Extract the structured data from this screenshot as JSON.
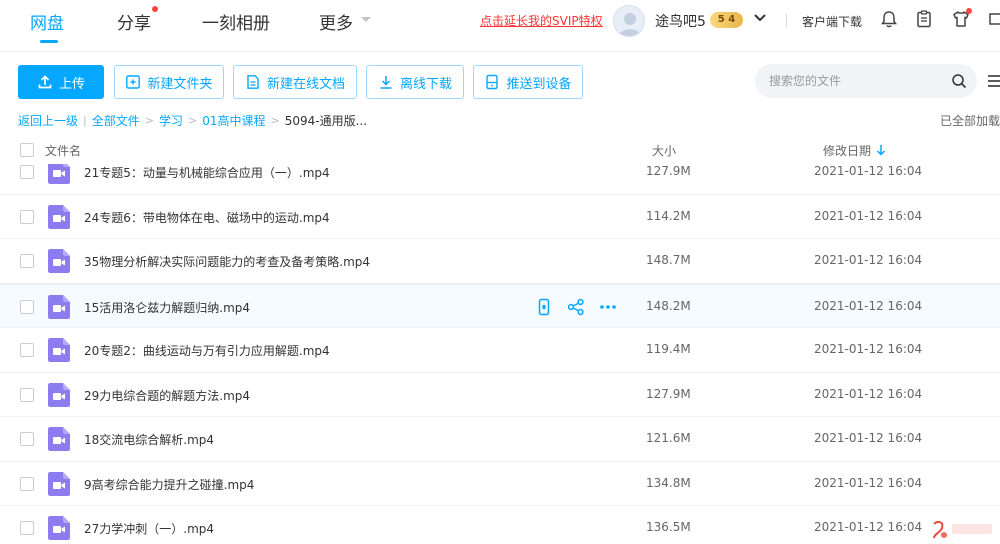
{
  "nav": {
    "items": [
      {
        "label": "网盘"
      },
      {
        "label": "分享"
      },
      {
        "label": "一刻相册"
      },
      {
        "label": "更多"
      }
    ],
    "promo": "点击延长我的SVIP特权",
    "username": "途鸟吧5",
    "vip_level": "5 4",
    "client_download": "客户端下载"
  },
  "toolbar": {
    "upload": "上传",
    "new_folder": "新建文件夹",
    "new_doc": "新建在线文档",
    "offline_download": "离线下载",
    "push_device": "推送到设备",
    "search_placeholder": "搜索您的文件"
  },
  "breadcrumb": {
    "back": "返回上一级",
    "items": [
      "全部文件",
      "学习",
      "01高中课程",
      "5094-通用版..."
    ],
    "status": "已全部加载"
  },
  "table": {
    "col_name": "文件名",
    "col_size": "大小",
    "col_date": "修改日期",
    "rows": [
      {
        "name": "21专题5：动量与机械能综合应用（一）.mp4",
        "size": "127.9M",
        "date": "2021-01-12 16:04"
      },
      {
        "name": "24专题6：带电物体在电、磁场中的运动.mp4",
        "size": "114.2M",
        "date": "2021-01-12 16:04"
      },
      {
        "name": "35物理分析解决实际问题能力的考查及备考策略.mp4",
        "size": "148.7M",
        "date": "2021-01-12 16:04"
      },
      {
        "name": "15活用洛仑兹力解题归纳.mp4",
        "size": "148.2M",
        "date": "2021-01-12 16:04"
      },
      {
        "name": "20专题2：曲线运动与万有引力应用解题.mp4",
        "size": "119.4M",
        "date": "2021-01-12 16:04"
      },
      {
        "name": "29力电综合题的解题方法.mp4",
        "size": "127.9M",
        "date": "2021-01-12 16:04"
      },
      {
        "name": "18交流电综合解析.mp4",
        "size": "121.6M",
        "date": "2021-01-12 16:04"
      },
      {
        "name": "9高考综合能力提升之碰撞.mp4",
        "size": "134.8M",
        "date": "2021-01-12 16:04"
      },
      {
        "name": "27力学冲刺（一）.mp4",
        "size": "136.5M",
        "date": "2021-01-12 16:04"
      }
    ]
  },
  "colors": {
    "accent": "#06a7ff",
    "video_icon": "#8c7cf0",
    "promo": "#ff3333"
  }
}
